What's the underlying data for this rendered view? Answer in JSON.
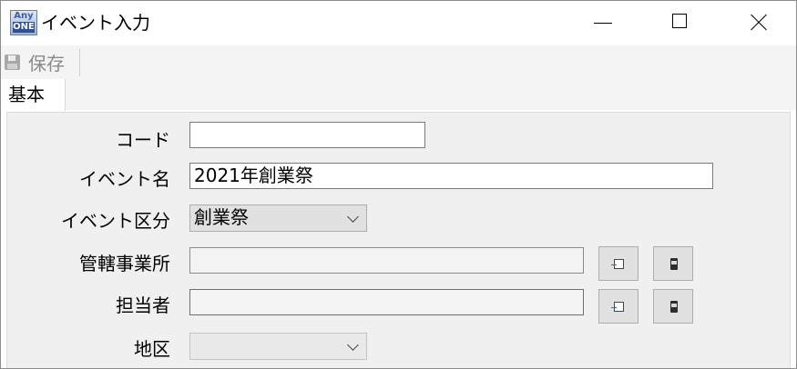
{
  "window": {
    "title": "イベント入力",
    "app_icon_text_top": "Any",
    "app_icon_text_bottom": "ONE",
    "controls": [
      "minimize",
      "maximize",
      "close"
    ]
  },
  "toolbar": {
    "save_label": "保存",
    "save_icon": "floppy-disk-icon"
  },
  "tabs": [
    {
      "label": "基本",
      "active": true
    }
  ],
  "form": {
    "code": {
      "label": "コード",
      "value": ""
    },
    "event_name": {
      "label": "イベント名",
      "value": "2021年創業祭"
    },
    "event_category": {
      "label": "イベント区分",
      "value": "創業祭"
    },
    "office": {
      "label": "管轄事業所",
      "value": "",
      "lookup_icon": "lookup-icon",
      "clear_icon": "clear-icon"
    },
    "person": {
      "label": "担当者",
      "value": "",
      "lookup_icon": "lookup-icon",
      "clear_icon": "clear-icon"
    },
    "region": {
      "label": "地区",
      "value": ""
    }
  }
}
